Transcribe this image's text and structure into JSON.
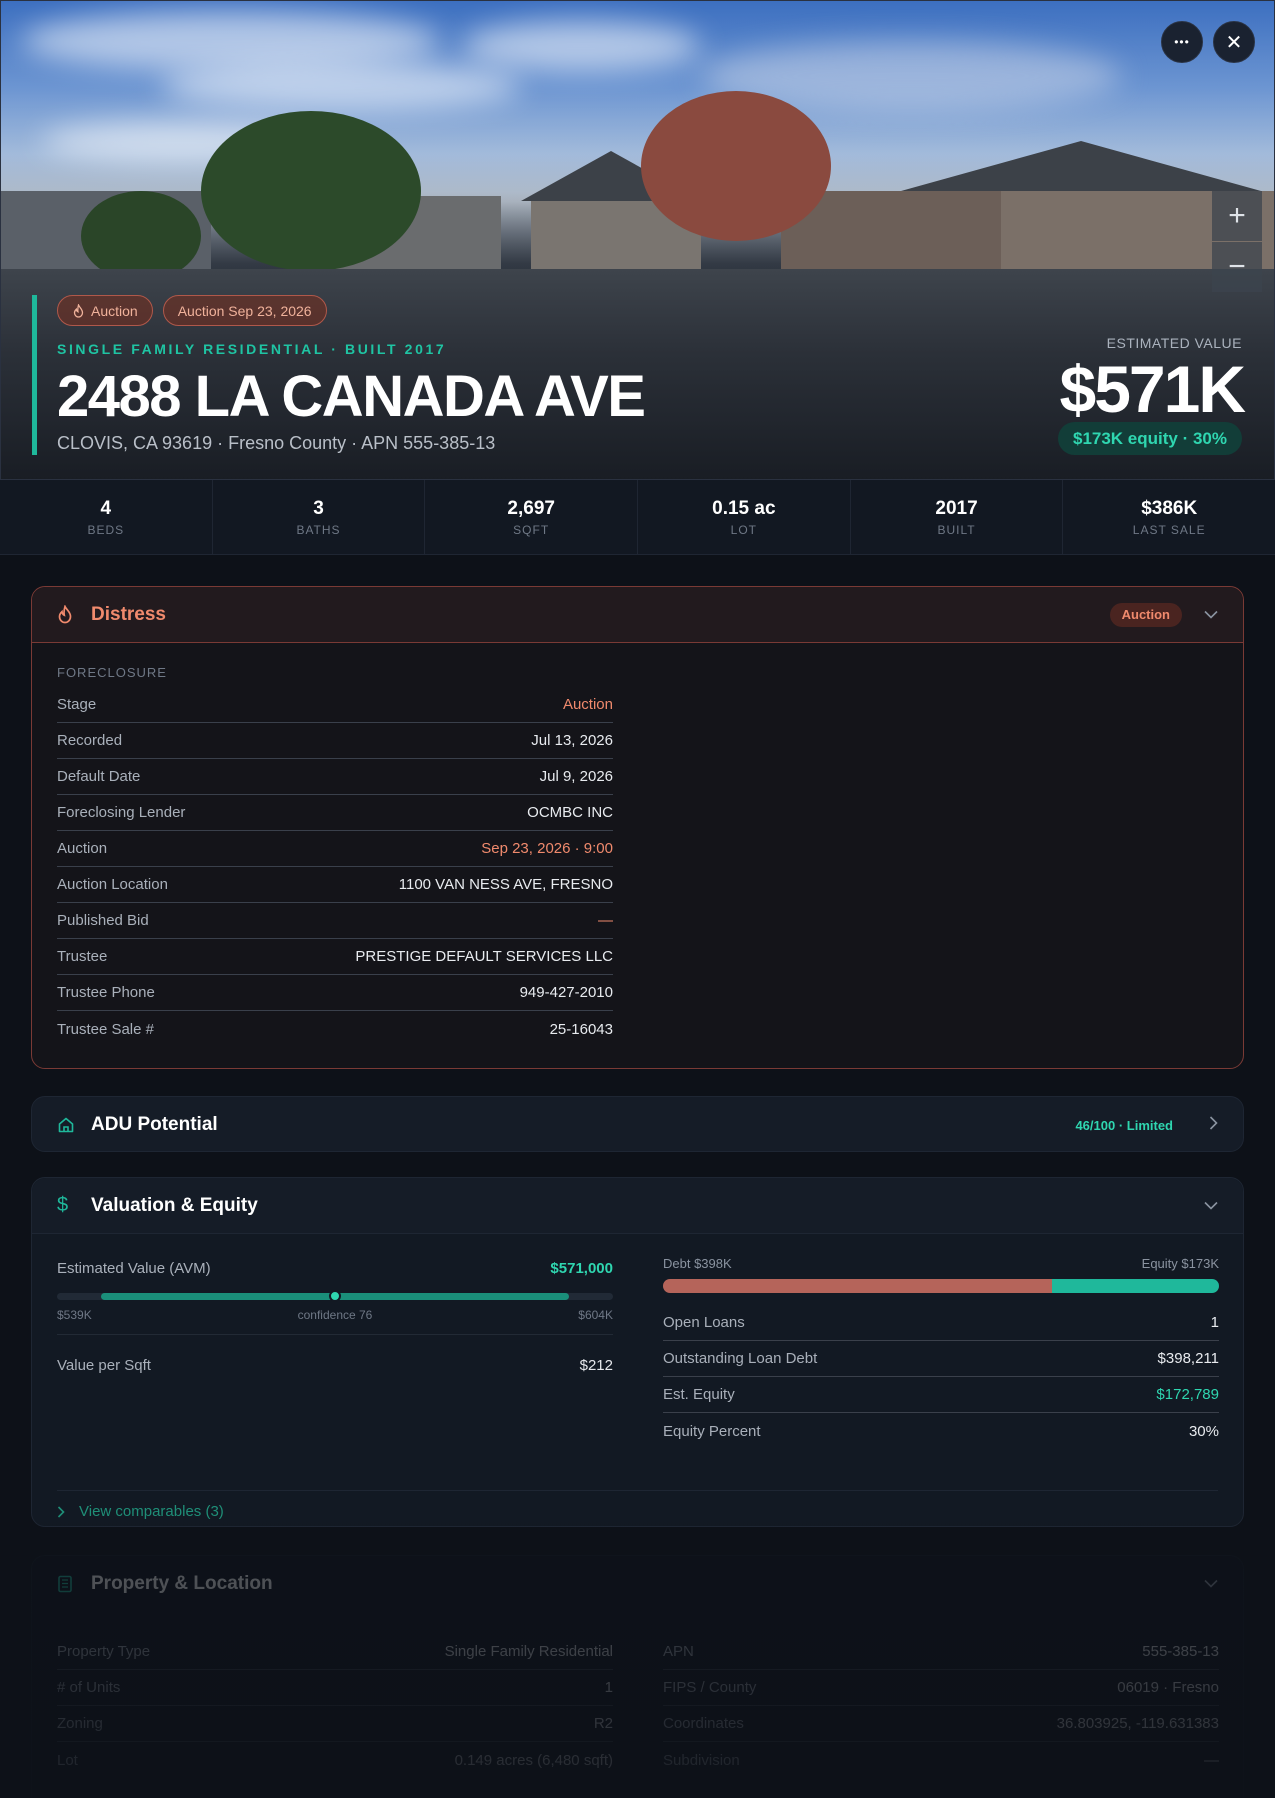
{
  "hero": {
    "tags": [
      "Auction",
      "Auction Sep 23, 2026"
    ],
    "subtitle": "SINGLE FAMILY RESIDENTIAL · BUILT 2017",
    "title": "2488 LA CANADA AVE",
    "address": "CLOVIS, CA 93619 · Fresno County · APN 555-385-13",
    "estimated_label": "ESTIMATED VALUE",
    "estimated_value": "$571K",
    "equity_pill": "$173K equity · 30%",
    "more_glyph": "•••",
    "close_glyph": "✕",
    "zoom_in_glyph": "+",
    "zoom_out_glyph": "−"
  },
  "stats": [
    {
      "value": "4",
      "label": "BEDS"
    },
    {
      "value": "3",
      "label": "BATHS"
    },
    {
      "value": "2,697",
      "label": "SQFT"
    },
    {
      "value": "0.15 ac",
      "label": "LOT"
    },
    {
      "value": "2017",
      "label": "BUILT"
    },
    {
      "value": "$386K",
      "label": "LAST SALE"
    }
  ],
  "distress": {
    "title": "Distress",
    "badge": "Auction",
    "section": "FORECLOSURE",
    "rows": [
      {
        "k": "Stage",
        "v": "Auction"
      },
      {
        "k": "Recorded",
        "v": "Jul 13, 2026"
      },
      {
        "k": "Default Date",
        "v": "Jul 9, 2026"
      },
      {
        "k": "Foreclosing Lender",
        "v": "OCMBC INC"
      },
      {
        "k": "Auction",
        "v": "Sep 23, 2026 · 9:00"
      },
      {
        "k": "Auction Location",
        "v": "1100 VAN NESS AVE, FRESNO"
      },
      {
        "k": "Published Bid",
        "v": "—"
      },
      {
        "k": "Trustee",
        "v": "PRESTIGE DEFAULT SERVICES LLC"
      },
      {
        "k": "Trustee Phone",
        "v": "949-427-2010"
      },
      {
        "k": "Trustee Sale #",
        "v": "25-16043"
      }
    ]
  },
  "adu": {
    "title": "ADU Potential",
    "score": "46/100 · Limited"
  },
  "valuation": {
    "title": "Valuation & Equity",
    "avm_label": "Estimated Value (AVM)",
    "avm_value": "$571,000",
    "range_low": "$539K",
    "confidence": "confidence 76",
    "range_high": "$604K",
    "vps_label": "Value per Sqft",
    "vps_value": "$212",
    "debt_label": "Debt $398K",
    "equity_label": "Equity $173K",
    "equity_fraction": 0.3,
    "avm_position": 0.5,
    "rows": [
      {
        "k": "Open Loans",
        "v": "1"
      },
      {
        "k": "Outstanding Loan Debt",
        "v": "$398,211"
      },
      {
        "k": "Est. Equity",
        "v": "$172,789"
      },
      {
        "k": "Equity Percent",
        "v": "30%"
      }
    ],
    "comparables": "View comparables (3)"
  },
  "property": {
    "title": "Property & Location",
    "left": [
      {
        "k": "Property Type",
        "v": "Single Family Residential"
      },
      {
        "k": "# of Units",
        "v": "1"
      },
      {
        "k": "Zoning",
        "v": "R2"
      },
      {
        "k": "Lot",
        "v": "0.149 acres (6,480 sqft)"
      }
    ],
    "right": [
      {
        "k": "APN",
        "v": "555-385-13"
      },
      {
        "k": "FIPS / County",
        "v": "06019 · Fresno"
      },
      {
        "k": "Coordinates",
        "v": "36.803925, -119.631383"
      },
      {
        "k": "Subdivision",
        "v": "—"
      }
    ]
  },
  "colors": {
    "accent": "#1fb89b",
    "hot": "#f08a6d",
    "debt": "#b5645a"
  }
}
